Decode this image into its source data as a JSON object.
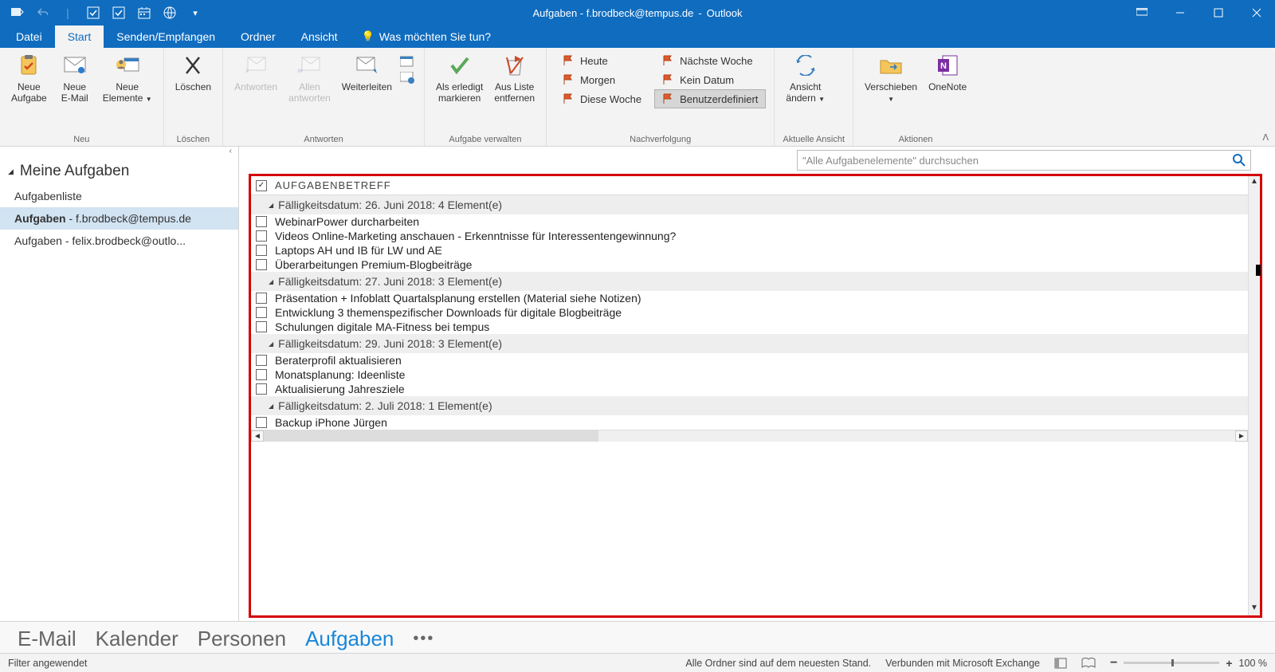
{
  "titlebar": {
    "title": "Aufgaben - f.brodbeck@tempus.de",
    "app": "Outlook"
  },
  "ribbon_tabs": {
    "datei": "Datei",
    "start": "Start",
    "senden": "Senden/Empfangen",
    "ordner": "Ordner",
    "ansicht": "Ansicht",
    "tell_me": "Was möchten Sie tun?"
  },
  "ribbon": {
    "neu": {
      "neue_aufgabe": "Neue\nAufgabe",
      "neue_email": "Neue\nE-Mail",
      "neue_elemente": "Neue\nElemente",
      "group": "Neu"
    },
    "loeschen": {
      "loeschen": "Löschen",
      "group": "Löschen"
    },
    "antworten": {
      "antworten": "Antworten",
      "allen": "Allen\nantworten",
      "weiterleiten": "Weiterleiten",
      "group": "Antworten"
    },
    "aufgabe_verwalten": {
      "erledigt": "Als erledigt\nmarkieren",
      "entfernen": "Aus Liste\nentfernen",
      "group": "Aufgabe verwalten"
    },
    "nachverfolgung": {
      "heute": "Heute",
      "morgen": "Morgen",
      "diese_woche": "Diese Woche",
      "naechste_woche": "Nächste Woche",
      "kein_datum": "Kein Datum",
      "benutzerdefiniert": "Benutzerdefiniert",
      "group": "Nachverfolgung"
    },
    "aktuelle_ansicht": {
      "ansicht_aendern": "Ansicht\nändern",
      "group": "Aktuelle Ansicht"
    },
    "aktionen": {
      "verschieben": "Verschieben",
      "onenote": "OneNote",
      "group": "Aktionen"
    }
  },
  "sidebar": {
    "collapse_icon": "‹",
    "header": "Meine Aufgaben",
    "items": [
      {
        "label": "Aufgabenliste"
      },
      {
        "label_bold": "Aufgaben",
        "label_rest": " - f.brodbeck@tempus.de",
        "selected": true
      },
      {
        "label_bold": "Aufgaben",
        "label_rest": " - felix.brodbeck@outlo..."
      }
    ]
  },
  "search": {
    "placeholder": "\"Alle Aufgabenelemente\" durchsuchen"
  },
  "tasks": {
    "column_header": "AUFGABENBETREFF",
    "groups": [
      {
        "title": "Fälligkeitsdatum: 26. Juni 2018: 4 Element(e)",
        "items": [
          "WebinarPower durcharbeiten",
          "Videos Online-Marketing anschauen - Erkenntnisse für Interessentengewinnung?",
          "Laptops AH und IB für LW und AE",
          "Überarbeitungen Premium-Blogbeiträge"
        ]
      },
      {
        "title": "Fälligkeitsdatum: 27. Juni 2018: 3 Element(e)",
        "items": [
          "Präsentation + Infoblatt Quartalsplanung erstellen (Material siehe Notizen)",
          "Entwicklung 3 themenspezifischer Downloads für digitale Blogbeiträge",
          "Schulungen digitale MA-Fitness bei tempus"
        ]
      },
      {
        "title": "Fälligkeitsdatum: 29. Juni 2018: 3 Element(e)",
        "items": [
          "Beraterprofil aktualisieren",
          "Monatsplanung: Ideenliste",
          "Aktualisierung Jahresziele"
        ]
      },
      {
        "title": "Fälligkeitsdatum: 2. Juli 2018: 1 Element(e)",
        "items": [
          "Backup iPhone Jürgen"
        ]
      }
    ]
  },
  "bottom_nav": {
    "email": "E-Mail",
    "kalender": "Kalender",
    "personen": "Personen",
    "aufgaben": "Aufgaben"
  },
  "status": {
    "filter": "Filter angewendet",
    "sync": "Alle Ordner sind auf dem neuesten Stand.",
    "connected": "Verbunden mit Microsoft Exchange",
    "zoom": "100 %"
  }
}
